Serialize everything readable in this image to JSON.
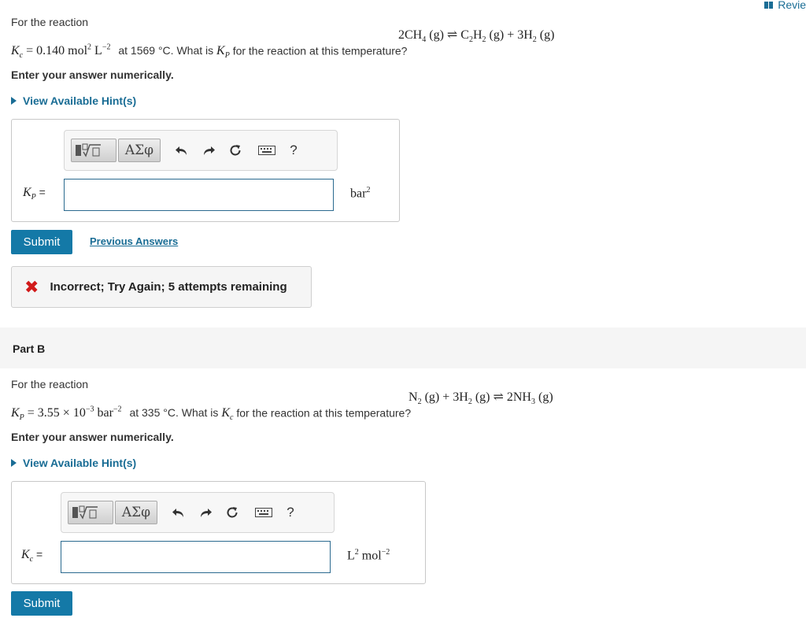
{
  "header": {
    "review_label": "Revie"
  },
  "partA": {
    "intro": "For the reaction",
    "equation": {
      "reactant": "2CH",
      "reactant_sub": "4",
      "phase": "(g)",
      "arrow": "⇌",
      "p1": "C",
      "p1_sub1": "2",
      "p1_h": "H",
      "p1_sub2": "2",
      "plus": "+",
      "p2": "3H",
      "p2_sub": "2"
    },
    "given": {
      "symbol": "K",
      "sub": "c",
      "value": "= 0.140 mol",
      "exp1": "2",
      "unit2": "L",
      "exp2": "−2",
      "text": "at 1569 °C. What is",
      "target": "K",
      "target_sub": "P",
      "rest": "for the reaction at this temperature?"
    },
    "instruction": "Enter your answer numerically.",
    "hint_label": "View Available Hint(s)",
    "field_label": "K",
    "field_sub": "P",
    "field_eq": "=",
    "unit": "bar",
    "unit_exp": "2",
    "input_value": "",
    "submit_label": "Submit",
    "previous_label": "Previous Answers",
    "feedback": "Incorrect; Try Again; 5 attempts remaining"
  },
  "partB": {
    "title": "Part B",
    "intro": "For the reaction",
    "equation": {
      "r1": "N",
      "r1_sub": "2",
      "phase": "(g)",
      "plus": "+",
      "r2": "3H",
      "r2_sub": "2",
      "arrow": "⇌",
      "p1": "2NH",
      "p1_sub": "3"
    },
    "given": {
      "symbol": "K",
      "sub": "P",
      "value": "= 3.55 × 10",
      "exp1": "−3",
      "unit": "bar",
      "exp2": "−2",
      "text": "at 335 °C. What is",
      "target": "K",
      "target_sub": "c",
      "rest": "for the reaction at this temperature?"
    },
    "instruction": "Enter your answer numerically.",
    "hint_label": "View Available Hint(s)",
    "field_label": "K",
    "field_sub": "c",
    "field_eq": "=",
    "unit1": "L",
    "unit1_exp": "2",
    "unit2": "mol",
    "unit2_exp": "−2",
    "input_value": "",
    "submit_label": "Submit"
  },
  "toolbar": {
    "greek_label": "ΑΣφ",
    "help_label": "?"
  },
  "colors": {
    "accent": "#1479a7",
    "link": "#1a6d95",
    "error": "#d11a1a"
  }
}
